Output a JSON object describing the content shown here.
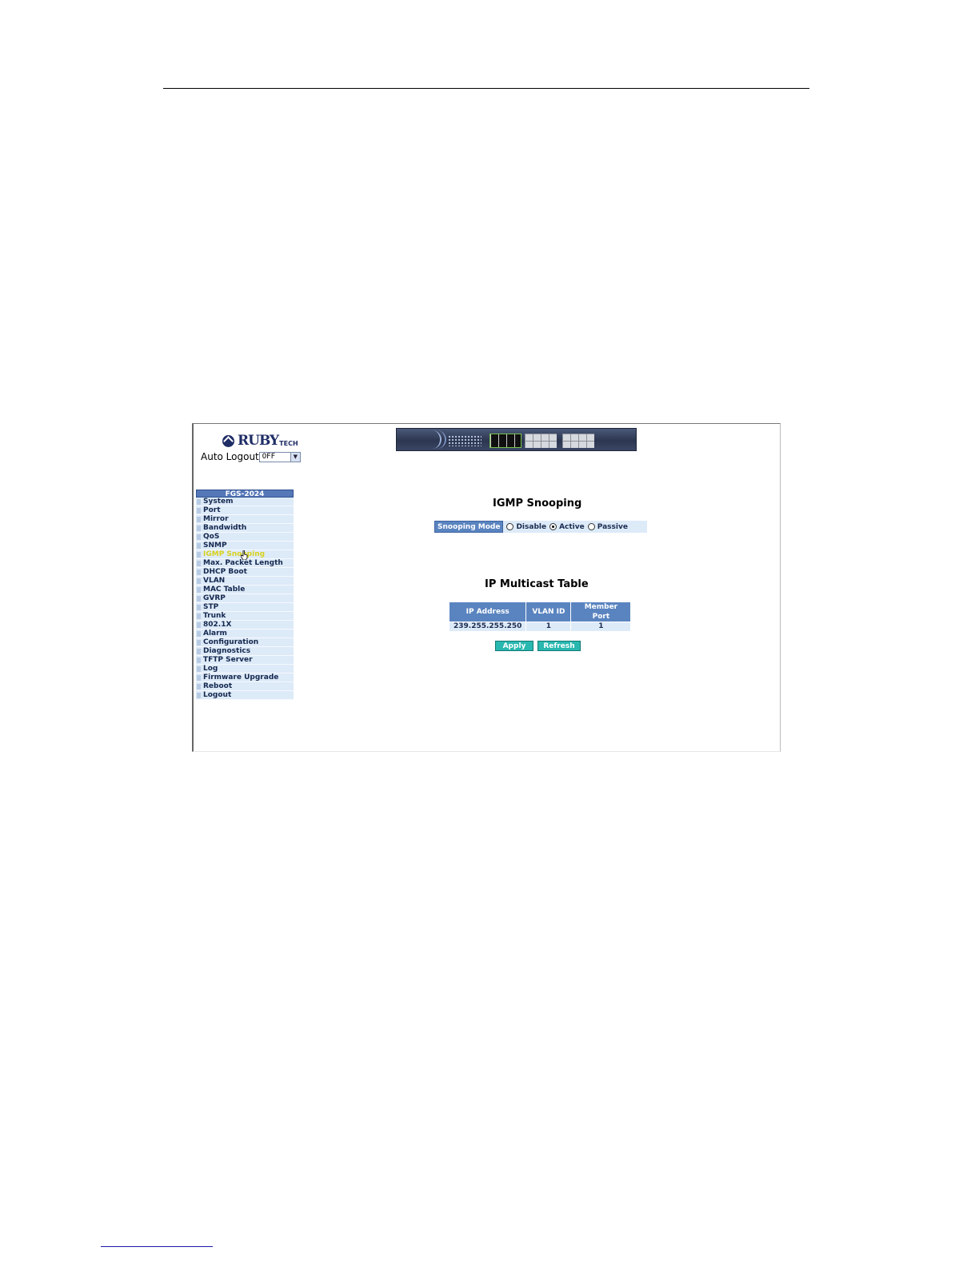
{
  "brand": {
    "name": "RUBY",
    "suffix": "TECH"
  },
  "auto_logout": {
    "label": "Auto Logout",
    "value": "OFF"
  },
  "menu": {
    "header": "FGS-2024",
    "items": [
      {
        "label": "System"
      },
      {
        "label": "Port"
      },
      {
        "label": "Mirror"
      },
      {
        "label": "Bandwidth"
      },
      {
        "label": "QoS"
      },
      {
        "label": "SNMP"
      },
      {
        "label": "IGMP Snooping",
        "active": true
      },
      {
        "label": "Max. Packet Length"
      },
      {
        "label": "DHCP Boot"
      },
      {
        "label": "VLAN"
      },
      {
        "label": "MAC Table"
      },
      {
        "label": "GVRP"
      },
      {
        "label": "STP"
      },
      {
        "label": "Trunk"
      },
      {
        "label": "802.1X"
      },
      {
        "label": "Alarm"
      },
      {
        "label": "Configuration"
      },
      {
        "label": "Diagnostics"
      },
      {
        "label": "TFTP Server"
      },
      {
        "label": "Log"
      },
      {
        "label": "Firmware Upgrade"
      },
      {
        "label": "Reboot"
      },
      {
        "label": "Logout"
      }
    ]
  },
  "igmp": {
    "title": "IGMP Snooping",
    "mode_label": "Snooping Mode",
    "options": [
      {
        "label": "Disable",
        "checked": false
      },
      {
        "label": "Active",
        "checked": true
      },
      {
        "label": "Passive",
        "checked": false
      }
    ]
  },
  "multicast": {
    "title": "IP Multicast Table",
    "columns": [
      "IP Address",
      "VLAN ID",
      "Member Port"
    ],
    "rows": [
      [
        "239.255.255.250",
        "1",
        "1"
      ]
    ]
  },
  "buttons": {
    "apply": "Apply",
    "refresh": "Refresh"
  },
  "colors": {
    "header_blue": "#5a84c0",
    "row_blue": "#ddeaf8",
    "button_teal": "#29b8b0",
    "active_menu": "#d9d21c"
  }
}
